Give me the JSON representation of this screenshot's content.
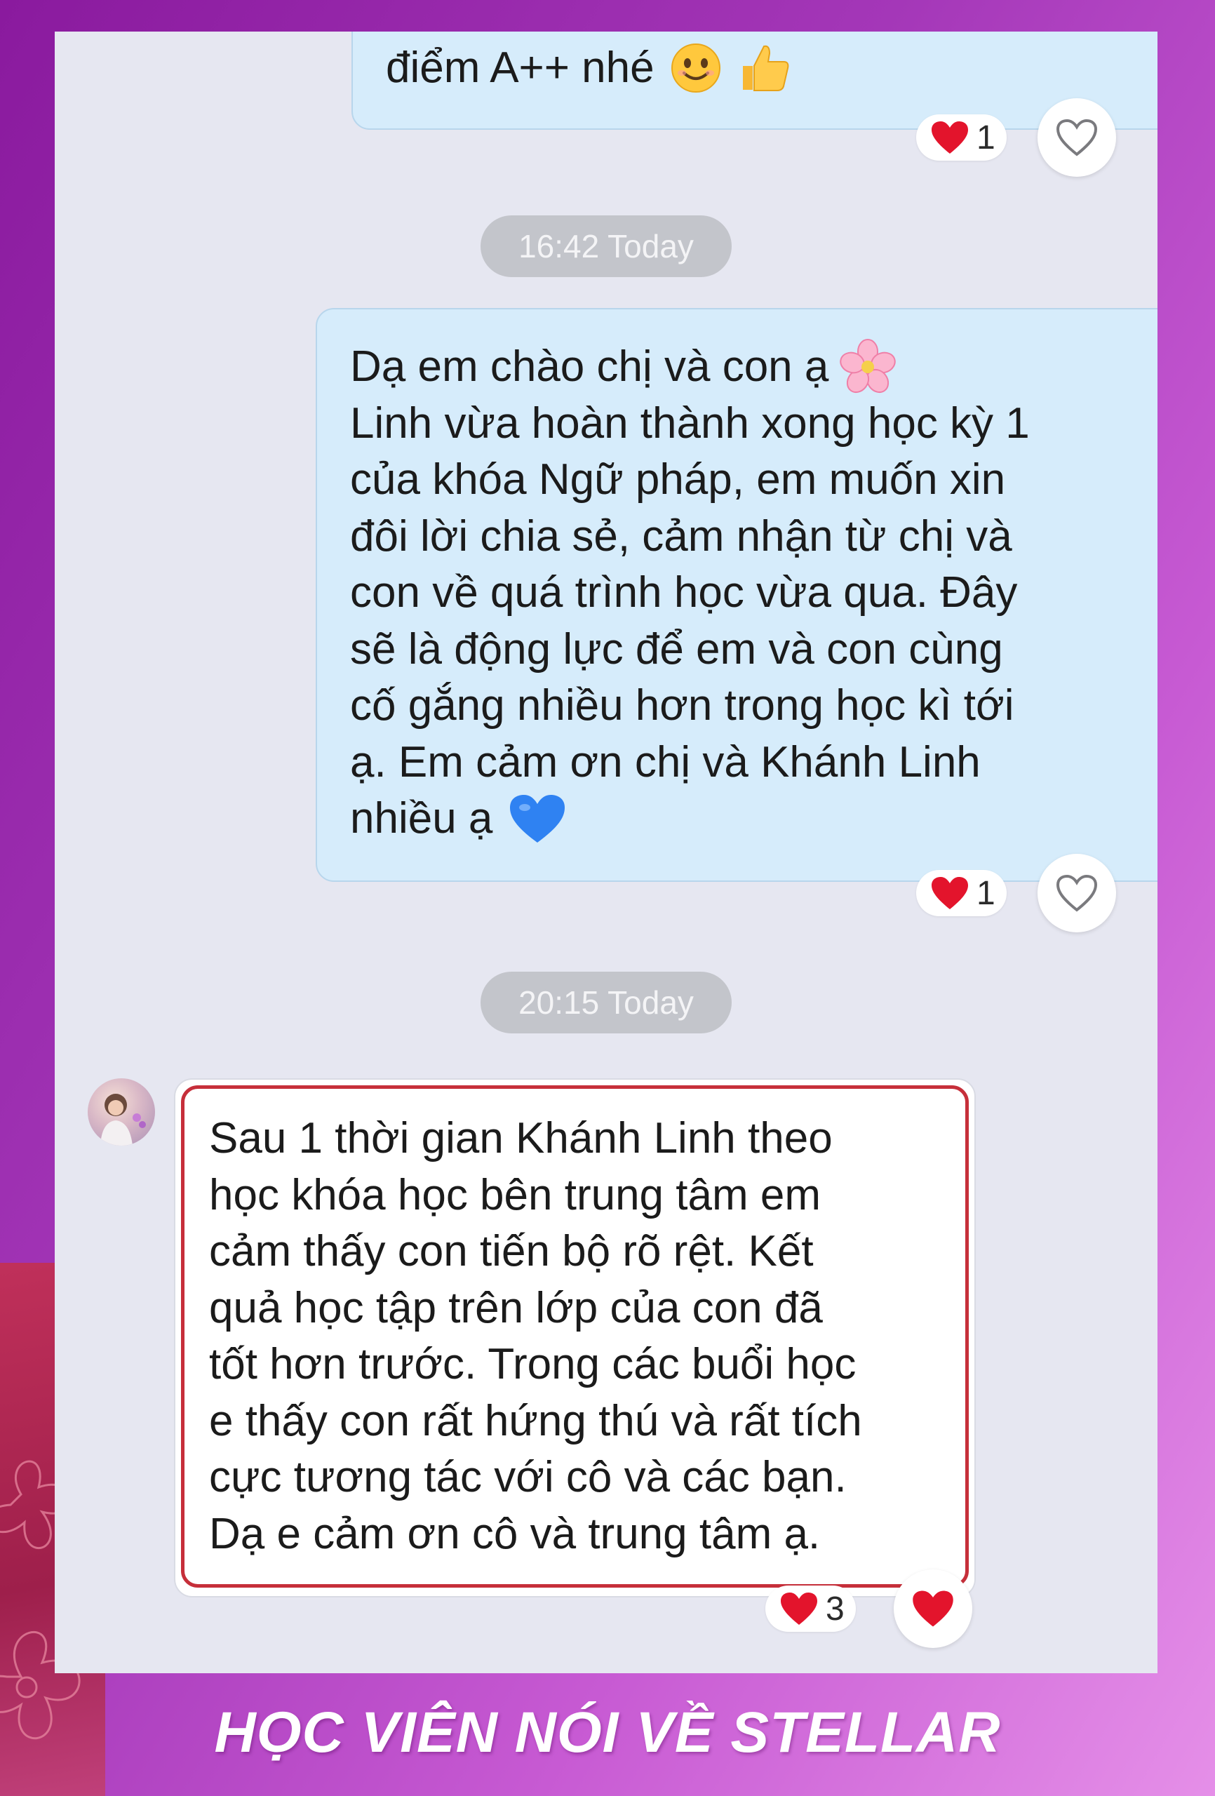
{
  "colors": {
    "frame_purple": "#8a1a9e",
    "frame_pink": "#e58fe8",
    "outgoing_bubble": "#d6ecfb",
    "incoming_bubble": "#ffffff",
    "highlight_border": "#c62f3a",
    "chat_background": "#e6e7f1",
    "timestamp_pill": "#c3c5cb",
    "heart_red": "#e3142c"
  },
  "messages": [
    {
      "direction": "outgoing",
      "text": "điểm A++ nhé",
      "emojis": [
        "smiling-face-emoji",
        "thumbs-up-emoji"
      ],
      "reaction": {
        "emoji": "red-heart",
        "count": "1"
      }
    },
    {
      "direction": "outgoing",
      "timestamp": "16:42 Today",
      "text_before": "Dạ em chào chị và con ạ",
      "text_lines": "Linh vừa hoàn thành xong học kỳ 1\ncủa khóa Ngữ pháp, em muốn xin\nđôi lời chia sẻ, cảm nhận từ chị và\ncon về quá trình học vừa qua. Đây\nsẽ là động lực  để em và con cùng\ncố gắng nhiều hơn trong học kì tới\nạ. Em cảm ơn chị và Khánh Linh",
      "text_last": "nhiều ạ",
      "emojis": [
        "cherry-blossom-emoji",
        "blue-heart-emoji"
      ],
      "reaction": {
        "emoji": "red-heart",
        "count": "1"
      }
    },
    {
      "direction": "incoming",
      "timestamp": "20:15 Today",
      "text": "Sau 1 thời gian Khánh Linh theo\nhọc khóa học bên trung tâm em\ncảm thấy con tiến bộ rõ rệt. Kết\nquả học tập trên lớp của con đã\ntốt hơn trước. Trong các buổi học\ne thấy con rất hứng thú và rất tích\ncực tương tác với cô và các bạn.\nDạ e cảm ơn cô và trung tâm ạ.",
      "highlighted": true,
      "reaction": {
        "emoji": "red-heart",
        "count": "3"
      }
    }
  ],
  "footer": {
    "title": "HỌC VIÊN NÓI VỀ STELLAR"
  }
}
